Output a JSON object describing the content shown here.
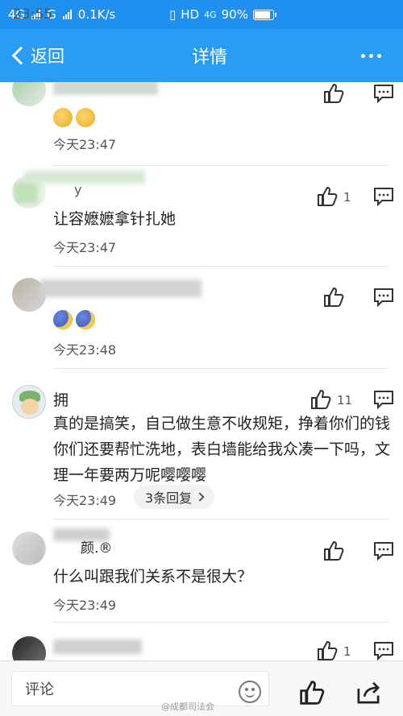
{
  "status_bar": {
    "left": "4G  G  0.1K/s",
    "net1": "4G",
    "net2": "G",
    "speed": "0.1K/s",
    "time": "23:55",
    "hd": "HD",
    "net3": "4G",
    "battery": "90%"
  },
  "nav": {
    "back_label": "返回",
    "title": "详情"
  },
  "comments": [
    {
      "name": "",
      "text": "",
      "time": "今天23:47",
      "like_count": ""
    },
    {
      "name": "y",
      "text": "让容嬷嬷拿针扎她",
      "time": "今天23:47",
      "like_count": "1"
    },
    {
      "name": "",
      "text": "",
      "time": "今天23:48",
      "like_count": ""
    },
    {
      "name": "拥",
      "text": "真的是搞笑，自己做生意不收规矩，挣着你们的钱你们还要帮忙洗地，表白墙能给我众凑一下吗，文理一年要两万呢嘤嘤嘤",
      "time": "今天23:49",
      "like_count": "11",
      "replies": "3条回复"
    },
    {
      "name": "颜.®",
      "text": "什么叫跟我们关系不是很大？",
      "time": "今天23:49",
      "like_count": ""
    },
    {
      "name": "",
      "text": "",
      "time": "",
      "like_count": "1"
    }
  ],
  "bottom_bar": {
    "comment_placeholder": "评论",
    "watermark": "@成都司法会"
  },
  "colors": {
    "status_bg": "#1f8ff0",
    "nav_bg": "#2b9cf3"
  },
  "icons": [
    "signal-icon",
    "battery-icon",
    "back-chevron-icon",
    "more-icon",
    "thumbs-up-icon",
    "reply-icon",
    "emoji-icon",
    "share-icon",
    "clap-emoji",
    "moon-emoji"
  ]
}
